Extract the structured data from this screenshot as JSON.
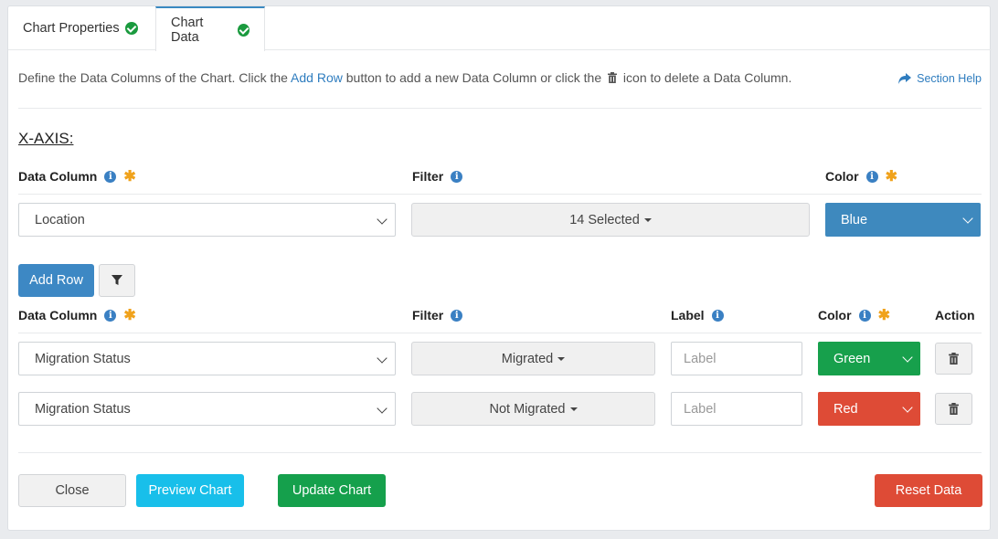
{
  "tabs": [
    {
      "label": "Chart Properties"
    },
    {
      "label": "Chart Data"
    }
  ],
  "description": {
    "before": "Define the Data Columns of the Chart. Click the ",
    "link": "Add Row",
    "middle": " button to add a new Data Column or click the ",
    "after": " icon to delete a Data Column."
  },
  "section_help": "Section Help",
  "xaxis": {
    "title": "X-AXIS:",
    "headers": {
      "data_column": "Data Column",
      "filter": "Filter",
      "color": "Color"
    },
    "row": {
      "data_column": "Location",
      "filter": "14 Selected",
      "color": "Blue"
    }
  },
  "toolbar": {
    "add_row": "Add Row"
  },
  "series": {
    "headers": {
      "data_column": "Data Column",
      "filter": "Filter",
      "label": "Label",
      "color": "Color",
      "action": "Action"
    },
    "rows": [
      {
        "data_column": "Migration Status",
        "filter": "Migrated",
        "label_placeholder": "Label",
        "color": "Green"
      },
      {
        "data_column": "Migration Status",
        "filter": "Not Migrated",
        "label_placeholder": "Label",
        "color": "Red"
      }
    ]
  },
  "footer": {
    "close": "Close",
    "preview": "Preview Chart",
    "update": "Update Chart",
    "reset": "Reset Data"
  },
  "colors": {
    "blue": "#3e89be",
    "green": "#17a04c",
    "red": "#de4b36",
    "accent": "#2f7dbf"
  }
}
